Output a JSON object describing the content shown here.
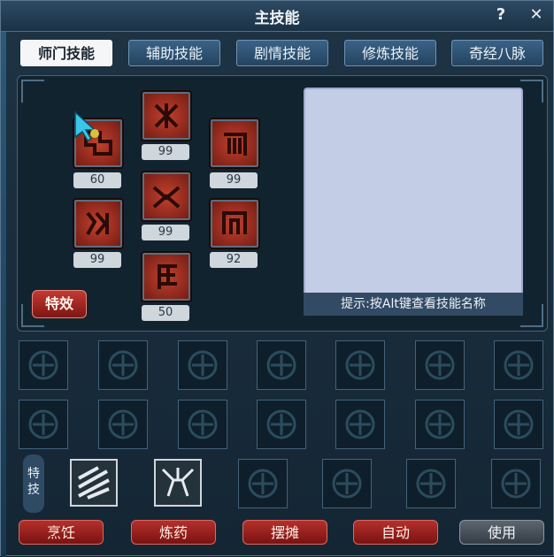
{
  "window": {
    "title": "主技能",
    "help": "?",
    "close": "✕"
  },
  "tabs": [
    {
      "label": "师门技能",
      "active": true
    },
    {
      "label": "辅助技能",
      "active": false
    },
    {
      "label": "剧情技能",
      "active": false
    },
    {
      "label": "修炼技能",
      "active": false
    },
    {
      "label": "奇经八脉",
      "active": false
    }
  ],
  "skills": [
    {
      "icon": "skill-1-icon",
      "level": "60"
    },
    {
      "icon": "skill-2-icon",
      "level": "99"
    },
    {
      "icon": "skill-3-icon",
      "level": "99"
    },
    {
      "icon": "skill-4-icon",
      "level": "99"
    },
    {
      "icon": "skill-5-icon",
      "level": "99"
    },
    {
      "icon": "skill-6-icon",
      "level": "92"
    },
    {
      "icon": "skill-7-icon",
      "level": "50"
    }
  ],
  "effect_button": "特效",
  "hint": "提示:按Alt键查看技能名称",
  "special_label": "特技",
  "bottom_buttons": [
    "烹饪",
    "炼药",
    "摆摊",
    "自动",
    "使用"
  ],
  "colors": {
    "accent_red": "#b4302c",
    "panel": "#122330",
    "desc_bg": "#c4cde6"
  }
}
